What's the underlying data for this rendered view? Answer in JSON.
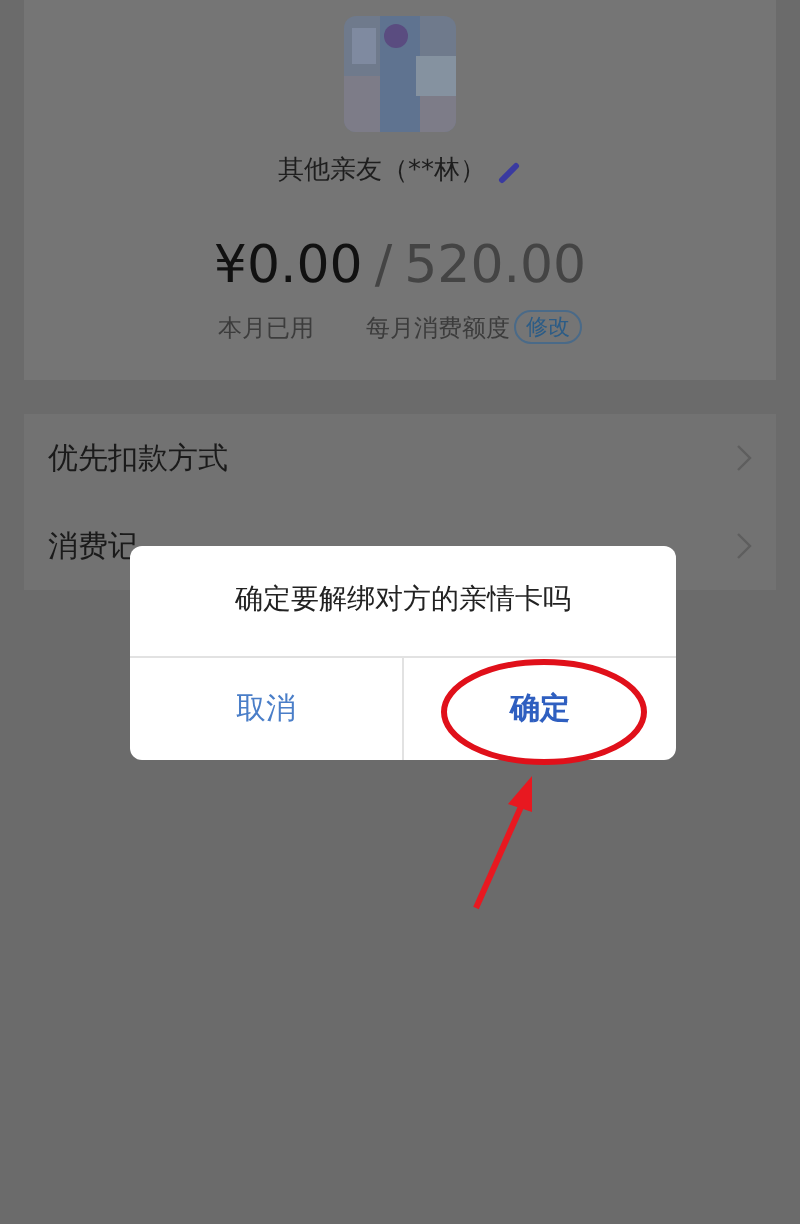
{
  "profile": {
    "name": "其他亲友（**林）",
    "amount_used": "¥0.00",
    "separator": "/",
    "monthly_limit": "520.00",
    "used_label": "本月已用",
    "limit_label": "每月消费额度",
    "edit_badge": "修改"
  },
  "menu": [
    {
      "label": "优先扣款方式"
    },
    {
      "label": "消费记"
    }
  ],
  "dialog": {
    "message": "确定要解绑对方的亲情卡吗",
    "buttons": [
      {
        "label": "取消",
        "highlighted": false
      },
      {
        "label": "确定",
        "highlighted": true
      }
    ]
  }
}
